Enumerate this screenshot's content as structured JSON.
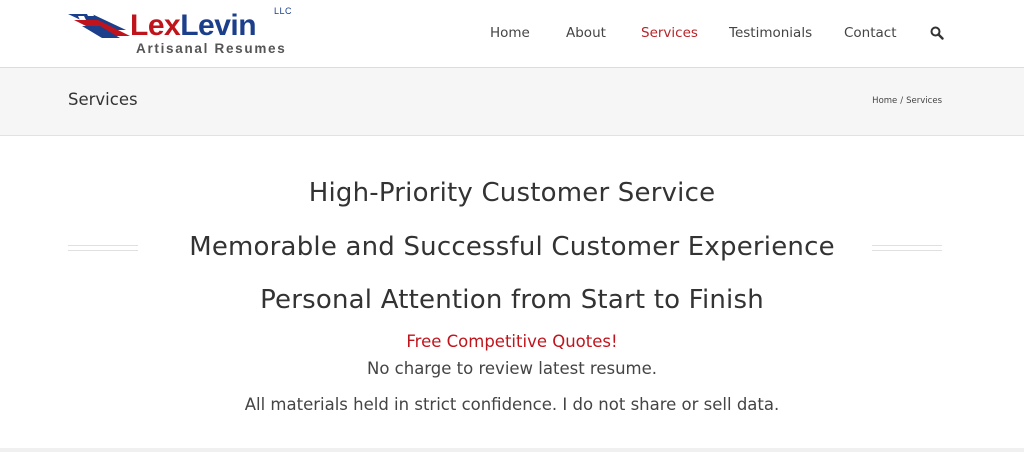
{
  "brand": {
    "name_first": "Lex",
    "name_last": "Levin",
    "suffix": "LLC",
    "tagline": "Artisanal Resumes",
    "colors": {
      "red": "#c0141c",
      "blue": "#1c3f8c"
    }
  },
  "nav": {
    "items": [
      {
        "label": "Home",
        "active": false
      },
      {
        "label": "About",
        "active": false
      },
      {
        "label": "Services",
        "active": true
      },
      {
        "label": "Testimonials",
        "active": false
      },
      {
        "label": "Contact",
        "active": false
      }
    ],
    "search_icon": "search-icon",
    "active_color": "#b5252a"
  },
  "page": {
    "title": "Services",
    "breadcrumb": [
      "Home",
      "Services"
    ],
    "breadcrumb_separator": "/"
  },
  "content": {
    "headlines": [
      "High-Priority Customer Service",
      "Memorable and Successful Customer Experience",
      "Personal Attention from Start to Finish"
    ],
    "quote": "Free Competitive Quotes!",
    "lines": [
      "No charge to review latest resume.",
      "All materials held in strict confidence. I do not share or sell data."
    ]
  }
}
